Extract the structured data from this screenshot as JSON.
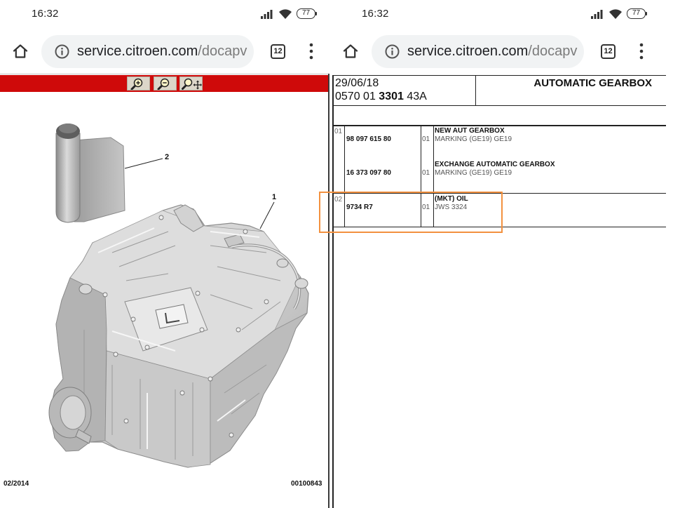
{
  "phones": [
    {
      "status_bar": {
        "time": "16:32",
        "battery": "77",
        "icons": [
          "signal-icon",
          "wifi-icon",
          "battery-icon"
        ]
      },
      "browser": {
        "url_host": "service.citroen.com",
        "url_path": "/docapv",
        "tab_count": "12",
        "icons": [
          "home-icon",
          "site-info-icon",
          "tabs-icon",
          "menu-icon"
        ]
      }
    },
    {
      "status_bar": {
        "time": "16:32",
        "battery": "77",
        "icons": [
          "signal-icon",
          "wifi-icon",
          "battery-icon"
        ]
      },
      "browser": {
        "url_host": "service.citroen.com",
        "url_path": "/docapv",
        "tab_count": "12",
        "icons": [
          "home-icon",
          "site-info-icon",
          "tabs-icon",
          "menu-icon"
        ]
      }
    }
  ],
  "viewer": {
    "toolbar_tools": [
      "zoom-in-icon",
      "zoom-out-icon",
      "zoom-move-icon"
    ],
    "callouts": [
      "1",
      "2"
    ],
    "footer_date": "02/2014",
    "footer_ref": "00100843"
  },
  "parts_list": {
    "date": "29/06/18",
    "reference": {
      "prefix": "0570 01",
      "bold": "3301",
      "suffix": "43A"
    },
    "title": "AUTOMATIC GEARBOX",
    "groups": [
      {
        "item": "01",
        "highlighted": false,
        "lines": [
          {
            "part_no": "98 097 615 80",
            "qty": "01",
            "name": "NEW AUT GEARBOX",
            "detail": "MARKING (GE19) GE19"
          },
          {
            "part_no": "16 373 097 80",
            "qty": "01",
            "name": "EXCHANGE AUTOMATIC GEARBOX",
            "detail": "MARKING (GE19) GE19"
          }
        ]
      },
      {
        "item": "02",
        "highlighted": true,
        "lines": [
          {
            "part_no": "9734 R7",
            "qty": "01",
            "name": "(MKT) OIL",
            "detail": "JWS 3324"
          }
        ]
      }
    ]
  },
  "colors": {
    "toolbar": "#cf0a0a",
    "highlight": "#f3913f",
    "url_path": "#7b7b7b"
  }
}
